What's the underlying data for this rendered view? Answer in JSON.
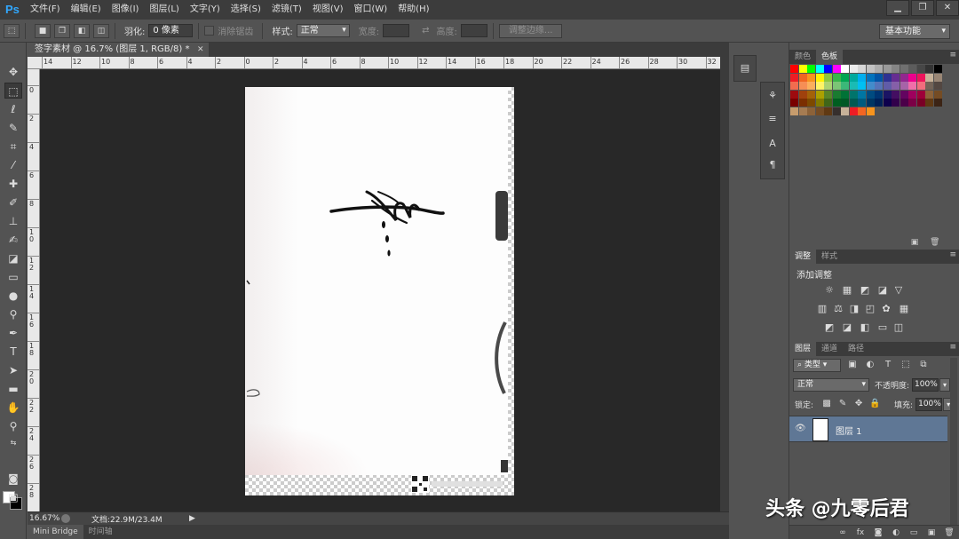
{
  "app": {
    "logo": "Ps",
    "menus": [
      "文件(F)",
      "编辑(E)",
      "图像(I)",
      "图层(L)",
      "文字(Y)",
      "选择(S)",
      "滤镜(T)",
      "视图(V)",
      "窗口(W)",
      "帮助(H)"
    ],
    "window_controls": [
      "▁",
      "❐",
      "✕"
    ]
  },
  "options_bar": {
    "feather_label": "羽化:",
    "feather_value": "0 像素",
    "antialias_label": "消除锯齿",
    "style_label": "样式:",
    "style_value": "正常",
    "width_label": "宽度:",
    "height_label": "高度:",
    "refine_edge_label": "调整边缘...",
    "workspace": "基本功能"
  },
  "document": {
    "tab_title": "签字素材 @ 16.7% (图层 1, RGB/8) *",
    "ruler_h_labels": [
      "14",
      "12",
      "10",
      "8",
      "6",
      "4",
      "2",
      "0",
      "2",
      "4",
      "6",
      "8",
      "10",
      "12",
      "14",
      "16",
      "18",
      "20",
      "22",
      "24",
      "26",
      "28",
      "30",
      "32"
    ],
    "ruler_v_labels": [
      "0",
      "2",
      "4",
      "6",
      "8",
      "10",
      "12",
      "14",
      "16",
      "18",
      "20",
      "22",
      "24",
      "26",
      "28"
    ]
  },
  "status": {
    "zoom": "16.67%",
    "doc_size": "文档:22.9M/23.4M"
  },
  "bottom_tabs": [
    "Mini Bridge",
    "时间轴"
  ],
  "swatches_panel": {
    "tabs": [
      "颜色",
      "色板"
    ],
    "colors": [
      "#ff0000",
      "#ffff00",
      "#00ff00",
      "#00ffff",
      "#0000ff",
      "#ff00ff",
      "#ffffff",
      "#ebebeb",
      "#d6d6d6",
      "#c2c2c2",
      "#adadad",
      "#999999",
      "#858585",
      "#707070",
      "#5c5c5c",
      "#474747",
      "#333333",
      "#000000",
      "#ee1d24",
      "#f16522",
      "#f7941d",
      "#fff200",
      "#8dc63f",
      "#39b54a",
      "#00a651",
      "#00a99d",
      "#00aeef",
      "#0072bc",
      "#0054a6",
      "#2e3192",
      "#662d91",
      "#92278f",
      "#ec008c",
      "#ed145b",
      "#c7b299",
      "#998675",
      "#f26c4f",
      "#f68e55",
      "#fbaf5c",
      "#fff467",
      "#acd372",
      "#7cc576",
      "#3bb878",
      "#1abbb4",
      "#00bff3",
      "#438ccb",
      "#5574b9",
      "#605ca8",
      "#855fa8",
      "#a763a8",
      "#f06ea9",
      "#f26d7d",
      "#736357",
      "#534741",
      "#9e0b0f",
      "#a0410d",
      "#a36209",
      "#aba000",
      "#598527",
      "#1a7b30",
      "#007236",
      "#00746b",
      "#0076a3",
      "#004b80",
      "#003471",
      "#1b1464",
      "#440e62",
      "#630460",
      "#9e005d",
      "#9e0039",
      "#8c6239",
      "#754c24",
      "#790000",
      "#7b2e00",
      "#7d4900",
      "#827b00",
      "#406618",
      "#005e20",
      "#005826",
      "#005952",
      "#005b7f",
      "#003663",
      "#002157",
      "#0d004c",
      "#32004b",
      "#4b0049",
      "#7b0046",
      "#7a0026",
      "#603913",
      "#3c2415",
      "#c69c6d",
      "#a67c52",
      "#8c6239",
      "#754c24",
      "#603913",
      "#362f2d",
      "#c7b299",
      "#ed1c24",
      "#f26522",
      "#f7941d"
    ]
  },
  "adjustments_panel": {
    "tabs": [
      "调整",
      "样式"
    ],
    "title": "添加调整"
  },
  "layers_panel": {
    "tabs": [
      "图层",
      "通道",
      "路径"
    ],
    "kind_filter": "类型",
    "blend_mode": "正常",
    "opacity_label": "不透明度:",
    "opacity_value": "100%",
    "lock_label": "锁定:",
    "fill_label": "填充:",
    "fill_value": "100%",
    "layers": [
      {
        "name": "图层 1"
      }
    ]
  },
  "watermark": "头条 @九零后君"
}
